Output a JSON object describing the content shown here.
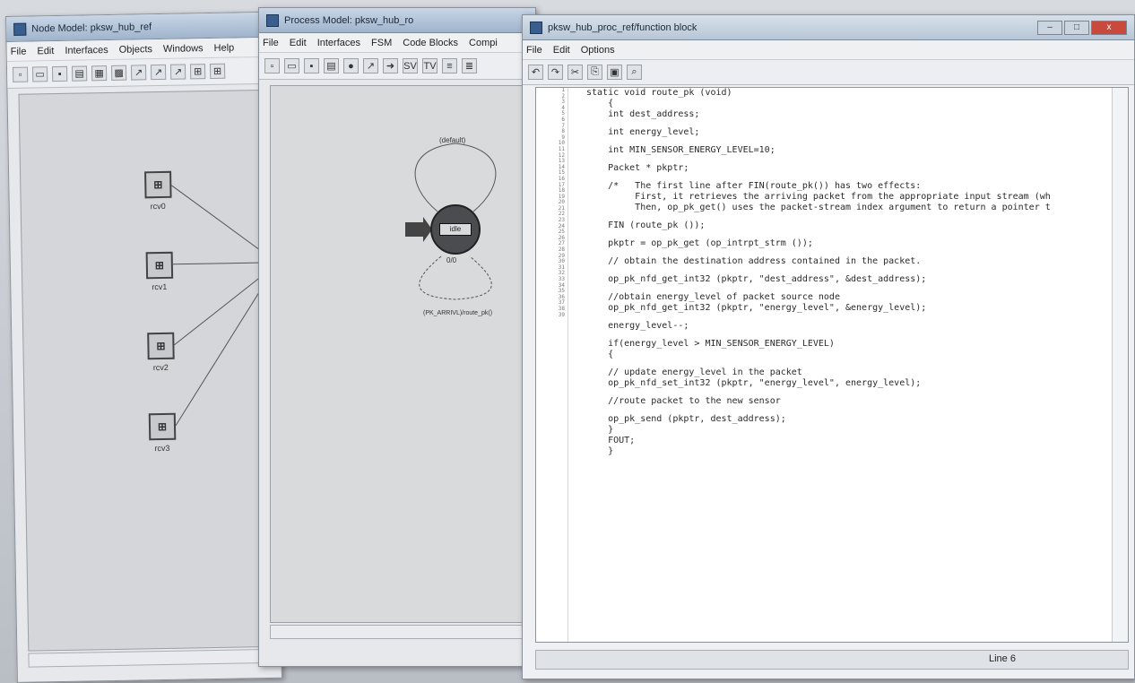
{
  "window1": {
    "title": "Node Model: pksw_hub_ref",
    "menu": [
      "File",
      "Edit",
      "Interfaces",
      "Objects",
      "Windows",
      "Help"
    ],
    "nodes": [
      {
        "label": "rcv0"
      },
      {
        "label": "rcv1"
      },
      {
        "label": "rcv2"
      },
      {
        "label": "rcv3"
      }
    ]
  },
  "window2": {
    "title": "Process Model: pksw_hub_ro",
    "menu": [
      "File",
      "Edit",
      "Interfaces",
      "FSM",
      "Code Blocks",
      "Compi"
    ],
    "toolbar": [
      "SV",
      "TV"
    ],
    "state_label": "idle",
    "state_count": "0/0",
    "transition_top": "(default)",
    "transition_bottom": "(PK_ARRIVL)/route_pk()"
  },
  "window3": {
    "title": "pksw_hub_proc_ref/function block",
    "menu": [
      "File",
      "Edit",
      "Options"
    ],
    "window_buttons": [
      "–",
      "□",
      "x"
    ],
    "status_line": "Line 6",
    "code_lines": [
      {
        "n": "1",
        "t": "static void route_pk (void)"
      },
      {
        "n": "2",
        "t": "    {"
      },
      {
        "n": "3",
        "t": "    int dest_address;"
      },
      {
        "n": "4",
        "t": ""
      },
      {
        "n": "5",
        "t": "    int energy_level;"
      },
      {
        "n": "6",
        "t": ""
      },
      {
        "n": "7",
        "t": "    int MIN_SENSOR_ENERGY_LEVEL=10;"
      },
      {
        "n": "8",
        "t": ""
      },
      {
        "n": "9",
        "t": "    Packet * pkptr;"
      },
      {
        "n": "10",
        "t": ""
      },
      {
        "n": "11",
        "t": "    /*   The first line after FIN(route_pk()) has two effects:"
      },
      {
        "n": "12",
        "t": "         First, it retrieves the arriving packet from the appropriate input stream (wh"
      },
      {
        "n": "13",
        "t": "         Then, op_pk_get() uses the packet-stream index argument to return a pointer t"
      },
      {
        "n": "14",
        "t": ""
      },
      {
        "n": "15",
        "t": "    FIN (route_pk ());"
      },
      {
        "n": "16",
        "t": ""
      },
      {
        "n": "17",
        "t": "    pkptr = op_pk_get (op_intrpt_strm ());"
      },
      {
        "n": "18",
        "t": ""
      },
      {
        "n": "19",
        "t": "    // obtain the destination address contained in the packet."
      },
      {
        "n": "20",
        "t": ""
      },
      {
        "n": "21",
        "t": "    op_pk_nfd_get_int32 (pkptr, \"dest_address\", &dest_address);"
      },
      {
        "n": "22",
        "t": ""
      },
      {
        "n": "23",
        "t": "    //obtain energy_level of packet source node"
      },
      {
        "n": "24",
        "t": "    op_pk_nfd_get_int32 (pkptr, \"energy_level\", &energy_level);"
      },
      {
        "n": "25",
        "t": ""
      },
      {
        "n": "26",
        "t": "    energy_level--;"
      },
      {
        "n": "27",
        "t": ""
      },
      {
        "n": "28",
        "t": "    if(energy_level > MIN_SENSOR_ENERGY_LEVEL)"
      },
      {
        "n": "29",
        "t": "    {"
      },
      {
        "n": "30",
        "t": ""
      },
      {
        "n": "31",
        "t": "    // update energy_level in the packet"
      },
      {
        "n": "32",
        "t": "    op_pk_nfd_set_int32 (pkptr, \"energy_level\", energy_level);"
      },
      {
        "n": "33",
        "t": ""
      },
      {
        "n": "34",
        "t": "    //route packet to the new sensor"
      },
      {
        "n": "35",
        "t": ""
      },
      {
        "n": "36",
        "t": "    op_pk_send (pkptr, dest_address);"
      },
      {
        "n": "37",
        "t": "    }"
      },
      {
        "n": "38",
        "t": "    FOUT;"
      },
      {
        "n": "39",
        "t": "    }"
      }
    ]
  }
}
